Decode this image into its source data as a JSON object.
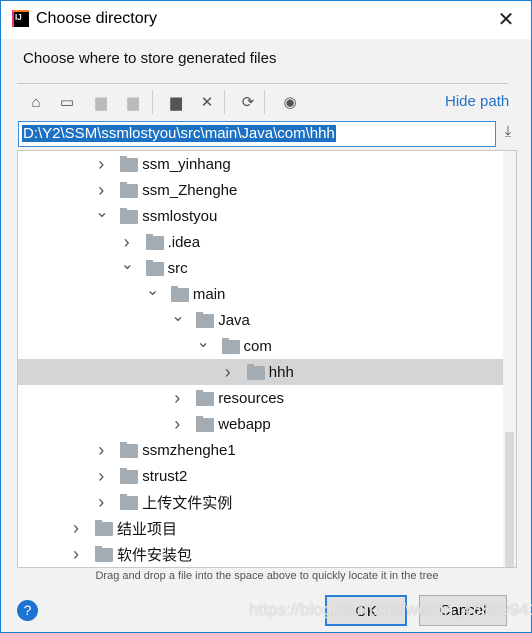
{
  "title": "Choose directory",
  "description": "Choose where to store generated files",
  "toolbar": {
    "icons": [
      "home-icon",
      "desktop-icon",
      "project-folder-icon",
      "module-folder-icon",
      "new-folder-icon",
      "delete-icon",
      "refresh-icon",
      "show-hidden-icon"
    ],
    "hide_path": "Hide path"
  },
  "path": "D:\\Y2\\SSM\\ssmlostyou\\src\\main\\Java\\com\\hhh",
  "tree": [
    {
      "label": "ssm_yinhang",
      "level": 2,
      "expanded": false
    },
    {
      "label": "ssm_Zhenghe",
      "level": 2,
      "expanded": false
    },
    {
      "label": "ssmlostyou",
      "level": 2,
      "expanded": true
    },
    {
      "label": ".idea",
      "level": 3,
      "expanded": false
    },
    {
      "label": "src",
      "level": 3,
      "expanded": true
    },
    {
      "label": "main",
      "level": 4,
      "expanded": true
    },
    {
      "label": "Java",
      "level": 5,
      "expanded": true
    },
    {
      "label": "com",
      "level": 6,
      "expanded": true
    },
    {
      "label": "hhh",
      "level": 7,
      "expanded": false,
      "selected": true
    },
    {
      "label": "resources",
      "level": 5,
      "expanded": false
    },
    {
      "label": "webapp",
      "level": 5,
      "expanded": false
    },
    {
      "label": "ssmzhenghe1",
      "level": 2,
      "expanded": false
    },
    {
      "label": "strust2",
      "level": 2,
      "expanded": false
    },
    {
      "label": "上传文件实例",
      "level": 2,
      "expanded": false
    },
    {
      "label": "结业项目",
      "level": 1,
      "expanded": false
    },
    {
      "label": "软件安装包",
      "level": 1,
      "expanded": false
    }
  ],
  "hint": "Drag and drop a file into the space above to quickly locate it in the tree",
  "buttons": {
    "ok": "OK",
    "cancel": "Cancel"
  },
  "watermark": "https://blog.csdn.net/weixin_43889941"
}
